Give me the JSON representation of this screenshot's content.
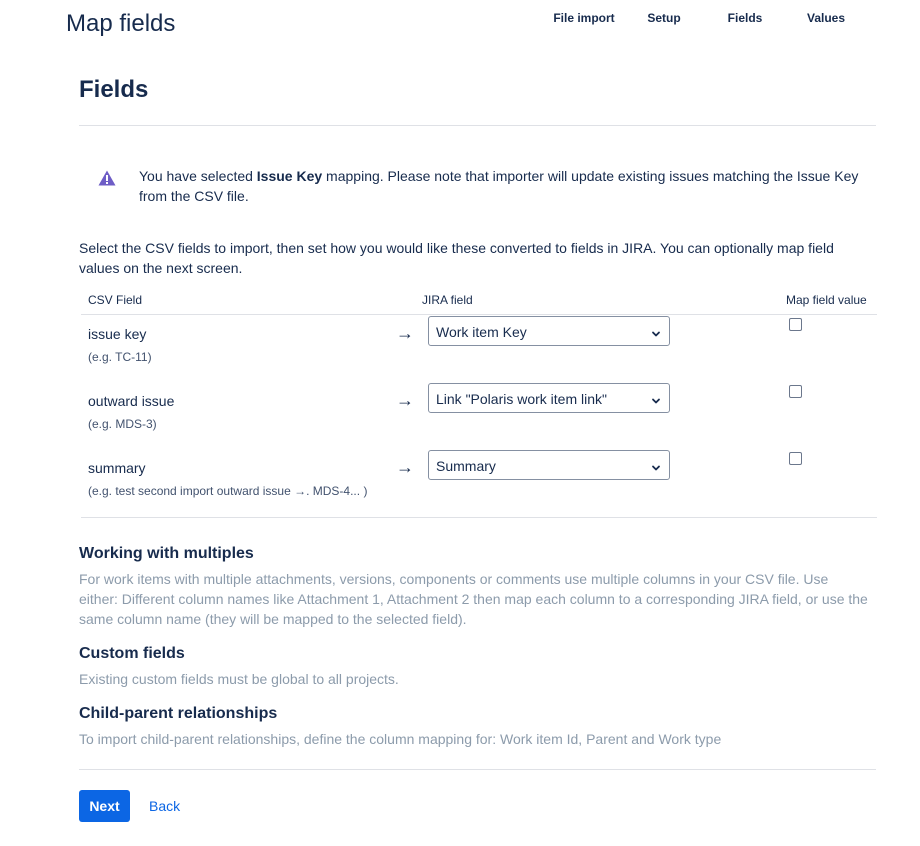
{
  "header": {
    "app_title": "Map fields",
    "steps": [
      {
        "label": "File import"
      },
      {
        "label": "Setup"
      },
      {
        "label": "Fields"
      },
      {
        "label": "Values"
      }
    ]
  },
  "page": {
    "title": "Fields"
  },
  "warning": {
    "icon": "warning-icon",
    "color": "#6e5dc6",
    "text_before": "You have selected ",
    "text_bold": "Issue Key",
    "text_after": " mapping. Please note that importer will update existing issues matching the Issue Key from the CSV file."
  },
  "intro": "Select the CSV fields to import, then set how you would like these converted to fields in JIRA. You can optionally map field values on the next screen.",
  "table": {
    "columns": [
      "CSV Field",
      "JIRA field",
      "Map field value"
    ],
    "rows": [
      {
        "csv_field": "issue key",
        "example": "(e.g. TC-11)",
        "jira_field": "Work item Key",
        "map_value": false
      },
      {
        "csv_field": "outward issue",
        "example": "(e.g. MDS-3)",
        "jira_field": "Link \"Polaris work item link\"",
        "map_value": false
      },
      {
        "csv_field": "summary",
        "example": "(e.g. test second import outward issue →. MDS-4... )",
        "jira_field": "Summary",
        "map_value": false
      }
    ]
  },
  "sections": [
    {
      "heading": "Working with multiples",
      "body": "For work items with multiple attachments, versions, components or comments use multiple columns in your CSV file. Use either: Different column names like Attachment 1, Attachment 2 then map each column to a corresponding JIRA field, or use the same column name (they will be mapped to the selected field)."
    },
    {
      "heading": "Custom fields",
      "body": "Existing custom fields must be global to all projects."
    },
    {
      "heading": "Child-parent relationships",
      "body": "To import child-parent relationships, define the column mapping for: Work item Id, Parent and Work type"
    }
  ],
  "actions": {
    "next_label": "Next",
    "back_label": "Back"
  },
  "colors": {
    "primary": "#0c66e4",
    "text": "#172b4d",
    "subtle_text": "#8c9bab",
    "divider": "#dfe1e6"
  }
}
